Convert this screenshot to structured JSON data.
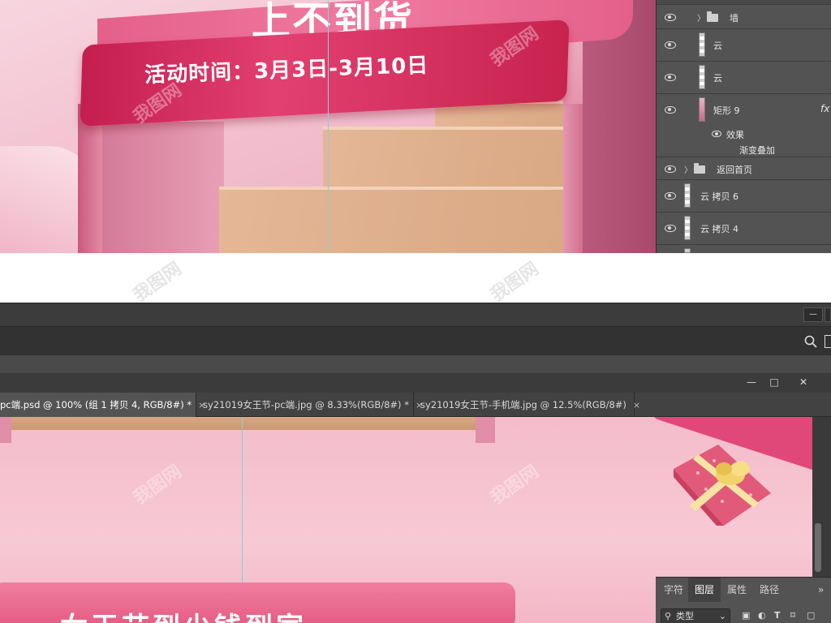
{
  "poster": {
    "headline_fragment": "上不到货",
    "event_time": "活动时间：3月3日-3月10日"
  },
  "layers_panel": {
    "rows": [
      {
        "name": "墙",
        "type": "folder"
      },
      {
        "name": "云",
        "type": "layer"
      },
      {
        "name": "云",
        "type": "layer"
      },
      {
        "name": "矩形 9",
        "type": "layer",
        "fx": "fx"
      },
      {
        "name": "效果",
        "type": "effect"
      },
      {
        "name": "渐变叠加",
        "type": "effect-item"
      },
      {
        "name": "返回首页",
        "type": "folder"
      },
      {
        "name": "云 拷贝 6",
        "type": "layer"
      },
      {
        "name": "云 拷贝 4",
        "type": "layer"
      }
    ]
  },
  "document_tabs": [
    {
      "label": "pc端.psd @ 100% (组 1 拷贝 4, RGB/8#) *",
      "close": "×",
      "active": true
    },
    {
      "label": "sy21019女王节-pc端.jpg @ 8.33%(RGB/8#) *",
      "close": "×",
      "active": false
    },
    {
      "label": "sy21019女王节-手机端.jpg @ 12.5%(RGB/8#)",
      "close": "×",
      "active": false
    }
  ],
  "window_controls": {
    "minimize": "—",
    "maximize": "□",
    "close": "✕"
  },
  "top_bar": {
    "minimize": "—"
  },
  "bottom_poster": {
    "banner_text": "女王节到少钱到家"
  },
  "mini_panel": {
    "tabs": [
      "字符",
      "图层",
      "属性",
      "路径"
    ],
    "active_tab": "图层",
    "more": "»",
    "kind_label": "类型"
  },
  "watermark": "我图网",
  "colors": {
    "ps_dark": "#535353",
    "ribbon_red": "#c41e4f",
    "poster_pink": "#f4bccb",
    "guide": "#7fd4d8"
  }
}
